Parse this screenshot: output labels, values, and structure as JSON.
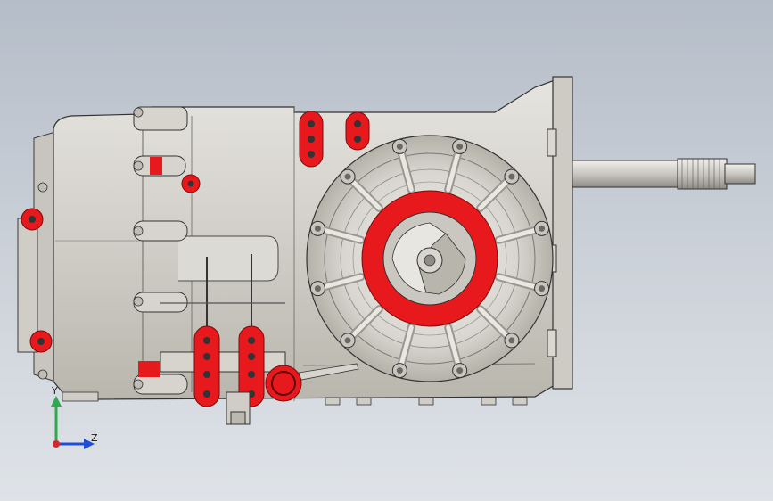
{
  "viewport": {
    "background_top": "#b5bdc8",
    "background_bottom": "#dfe3e8",
    "highlight_color": "#e8191c",
    "body_color": "#d4d2cc"
  },
  "model": {
    "name": "",
    "parts": [
      "main-housing",
      "bellhousing-face",
      "output-shaft",
      "rear-flange",
      "selector-brackets",
      "shift-rods",
      "bearing-retainer"
    ]
  },
  "triad": {
    "y_label": "Y",
    "z_label": "Z",
    "y_color": "#2fa84f",
    "z_color": "#1f4fd6",
    "x_color": "#d6262b"
  }
}
